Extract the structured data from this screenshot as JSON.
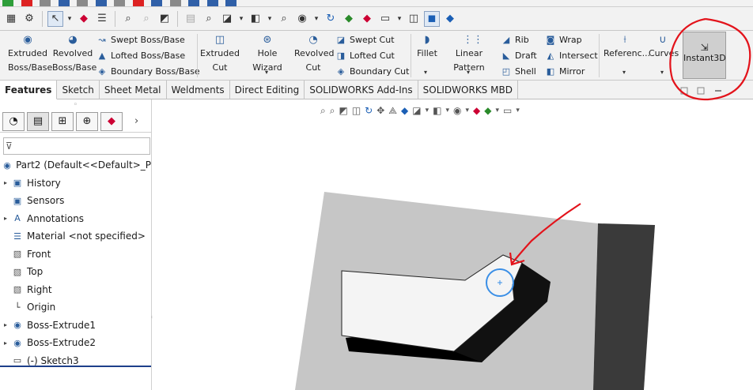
{
  "ribbon": {
    "extruded_boss_line1": "Extruded",
    "extruded_boss_line2": "Boss/Base",
    "revolved_boss_line1": "Revolved",
    "revolved_boss_line2": "Boss/Base",
    "swept_boss": "Swept Boss/Base",
    "lofted_boss": "Lofted Boss/Base",
    "boundary_boss": "Boundary Boss/Base",
    "extruded_cut_line1": "Extruded",
    "extruded_cut_line2": "Cut",
    "hole_wizard": "Hole Wizard",
    "revolved_cut_line1": "Revolved",
    "revolved_cut_line2": "Cut",
    "swept_cut": "Swept Cut",
    "lofted_cut": "Lofted Cut",
    "boundary_cut": "Boundary Cut",
    "fillet": "Fillet",
    "linear_pattern": "Linear Pattern",
    "rib": "Rib",
    "draft": "Draft",
    "shell": "Shell",
    "wrap": "Wrap",
    "intersect": "Intersect",
    "mirror": "Mirror",
    "reference": "Referenc...",
    "curves": "Curves",
    "instant3d": "Instant3D"
  },
  "tabs": [
    "Features",
    "Sketch",
    "Sheet Metal",
    "Weldments",
    "Direct Editing",
    "SOLIDWORKS Add-Ins",
    "SOLIDWORKS MBD"
  ],
  "tree": {
    "root": "Part2  (Default<<Default>_P",
    "items": [
      {
        "label": "History",
        "expandable": true,
        "icon": "history-folder-icon"
      },
      {
        "label": "Sensors",
        "expandable": false,
        "icon": "sensors-icon"
      },
      {
        "label": "Annotations",
        "expandable": true,
        "icon": "annotations-icon"
      },
      {
        "label": "Material <not specified>",
        "expandable": false,
        "icon": "material-icon"
      },
      {
        "label": "Front",
        "expandable": false,
        "icon": "plane-icon"
      },
      {
        "label": "Top",
        "expandable": false,
        "icon": "plane-icon"
      },
      {
        "label": "Right",
        "expandable": false,
        "icon": "plane-icon"
      },
      {
        "label": "Origin",
        "expandable": false,
        "icon": "origin-icon"
      },
      {
        "label": "Boss-Extrude1",
        "expandable": true,
        "icon": "extrude-feature-icon"
      },
      {
        "label": "Boss-Extrude2",
        "expandable": true,
        "icon": "extrude-feature-icon"
      },
      {
        "label": "(-) Sketch3",
        "expandable": false,
        "icon": "sketch-icon",
        "selected": true
      }
    ]
  },
  "colors": {
    "annotation_red": "#e3131b",
    "selection_blue": "#3b8fe6",
    "accent_blue": "#1d3f8a",
    "block_face": "#c6c6c6",
    "block_side": "#3a3a3a",
    "slot_face": "#f4f4f4"
  }
}
